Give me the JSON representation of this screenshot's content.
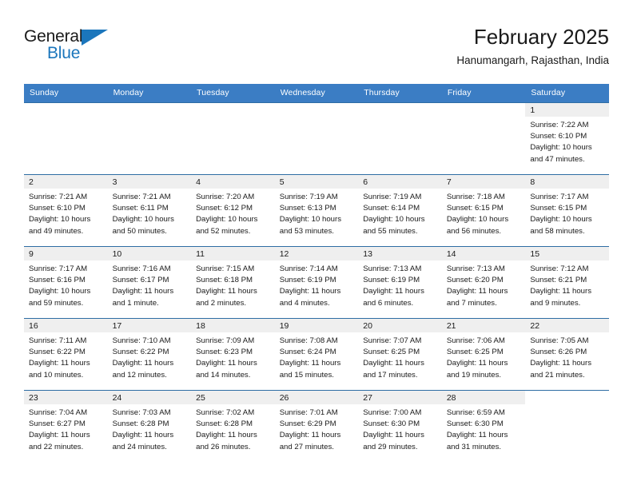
{
  "brand": {
    "word_one": "General",
    "word_two": "Blue",
    "accent_color": "#1b76bc"
  },
  "header": {
    "title": "February 2025",
    "subtitle": "Hanumangarh, Rajasthan, India"
  },
  "calendar": {
    "header_bg": "#3b7dc4",
    "row_border_color": "#2e6da4",
    "daynum_band_bg": "#efefef",
    "weekdays": [
      "Sunday",
      "Monday",
      "Tuesday",
      "Wednesday",
      "Thursday",
      "Friday",
      "Saturday"
    ],
    "labels": {
      "sunrise": "Sunrise:",
      "sunset": "Sunset:",
      "daylight": "Daylight:"
    },
    "weeks": [
      [
        {
          "day": "",
          "empty": true
        },
        {
          "day": "",
          "empty": true
        },
        {
          "day": "",
          "empty": true
        },
        {
          "day": "",
          "empty": true
        },
        {
          "day": "",
          "empty": true
        },
        {
          "day": "",
          "empty": true
        },
        {
          "day": "1",
          "sunrise": "Sunrise: 7:22 AM",
          "sunset": "Sunset: 6:10 PM",
          "daylight": "Daylight: 10 hours and 47 minutes."
        }
      ],
      [
        {
          "day": "2",
          "sunrise": "Sunrise: 7:21 AM",
          "sunset": "Sunset: 6:10 PM",
          "daylight": "Daylight: 10 hours and 49 minutes."
        },
        {
          "day": "3",
          "sunrise": "Sunrise: 7:21 AM",
          "sunset": "Sunset: 6:11 PM",
          "daylight": "Daylight: 10 hours and 50 minutes."
        },
        {
          "day": "4",
          "sunrise": "Sunrise: 7:20 AM",
          "sunset": "Sunset: 6:12 PM",
          "daylight": "Daylight: 10 hours and 52 minutes."
        },
        {
          "day": "5",
          "sunrise": "Sunrise: 7:19 AM",
          "sunset": "Sunset: 6:13 PM",
          "daylight": "Daylight: 10 hours and 53 minutes."
        },
        {
          "day": "6",
          "sunrise": "Sunrise: 7:19 AM",
          "sunset": "Sunset: 6:14 PM",
          "daylight": "Daylight: 10 hours and 55 minutes."
        },
        {
          "day": "7",
          "sunrise": "Sunrise: 7:18 AM",
          "sunset": "Sunset: 6:15 PM",
          "daylight": "Daylight: 10 hours and 56 minutes."
        },
        {
          "day": "8",
          "sunrise": "Sunrise: 7:17 AM",
          "sunset": "Sunset: 6:15 PM",
          "daylight": "Daylight: 10 hours and 58 minutes."
        }
      ],
      [
        {
          "day": "9",
          "sunrise": "Sunrise: 7:17 AM",
          "sunset": "Sunset: 6:16 PM",
          "daylight": "Daylight: 10 hours and 59 minutes."
        },
        {
          "day": "10",
          "sunrise": "Sunrise: 7:16 AM",
          "sunset": "Sunset: 6:17 PM",
          "daylight": "Daylight: 11 hours and 1 minute."
        },
        {
          "day": "11",
          "sunrise": "Sunrise: 7:15 AM",
          "sunset": "Sunset: 6:18 PM",
          "daylight": "Daylight: 11 hours and 2 minutes."
        },
        {
          "day": "12",
          "sunrise": "Sunrise: 7:14 AM",
          "sunset": "Sunset: 6:19 PM",
          "daylight": "Daylight: 11 hours and 4 minutes."
        },
        {
          "day": "13",
          "sunrise": "Sunrise: 7:13 AM",
          "sunset": "Sunset: 6:19 PM",
          "daylight": "Daylight: 11 hours and 6 minutes."
        },
        {
          "day": "14",
          "sunrise": "Sunrise: 7:13 AM",
          "sunset": "Sunset: 6:20 PM",
          "daylight": "Daylight: 11 hours and 7 minutes."
        },
        {
          "day": "15",
          "sunrise": "Sunrise: 7:12 AM",
          "sunset": "Sunset: 6:21 PM",
          "daylight": "Daylight: 11 hours and 9 minutes."
        }
      ],
      [
        {
          "day": "16",
          "sunrise": "Sunrise: 7:11 AM",
          "sunset": "Sunset: 6:22 PM",
          "daylight": "Daylight: 11 hours and 10 minutes."
        },
        {
          "day": "17",
          "sunrise": "Sunrise: 7:10 AM",
          "sunset": "Sunset: 6:22 PM",
          "daylight": "Daylight: 11 hours and 12 minutes."
        },
        {
          "day": "18",
          "sunrise": "Sunrise: 7:09 AM",
          "sunset": "Sunset: 6:23 PM",
          "daylight": "Daylight: 11 hours and 14 minutes."
        },
        {
          "day": "19",
          "sunrise": "Sunrise: 7:08 AM",
          "sunset": "Sunset: 6:24 PM",
          "daylight": "Daylight: 11 hours and 15 minutes."
        },
        {
          "day": "20",
          "sunrise": "Sunrise: 7:07 AM",
          "sunset": "Sunset: 6:25 PM",
          "daylight": "Daylight: 11 hours and 17 minutes."
        },
        {
          "day": "21",
          "sunrise": "Sunrise: 7:06 AM",
          "sunset": "Sunset: 6:25 PM",
          "daylight": "Daylight: 11 hours and 19 minutes."
        },
        {
          "day": "22",
          "sunrise": "Sunrise: 7:05 AM",
          "sunset": "Sunset: 6:26 PM",
          "daylight": "Daylight: 11 hours and 21 minutes."
        }
      ],
      [
        {
          "day": "23",
          "sunrise": "Sunrise: 7:04 AM",
          "sunset": "Sunset: 6:27 PM",
          "daylight": "Daylight: 11 hours and 22 minutes."
        },
        {
          "day": "24",
          "sunrise": "Sunrise: 7:03 AM",
          "sunset": "Sunset: 6:28 PM",
          "daylight": "Daylight: 11 hours and 24 minutes."
        },
        {
          "day": "25",
          "sunrise": "Sunrise: 7:02 AM",
          "sunset": "Sunset: 6:28 PM",
          "daylight": "Daylight: 11 hours and 26 minutes."
        },
        {
          "day": "26",
          "sunrise": "Sunrise: 7:01 AM",
          "sunset": "Sunset: 6:29 PM",
          "daylight": "Daylight: 11 hours and 27 minutes."
        },
        {
          "day": "27",
          "sunrise": "Sunrise: 7:00 AM",
          "sunset": "Sunset: 6:30 PM",
          "daylight": "Daylight: 11 hours and 29 minutes."
        },
        {
          "day": "28",
          "sunrise": "Sunrise: 6:59 AM",
          "sunset": "Sunset: 6:30 PM",
          "daylight": "Daylight: 11 hours and 31 minutes."
        },
        {
          "day": "",
          "empty": true
        }
      ]
    ]
  }
}
